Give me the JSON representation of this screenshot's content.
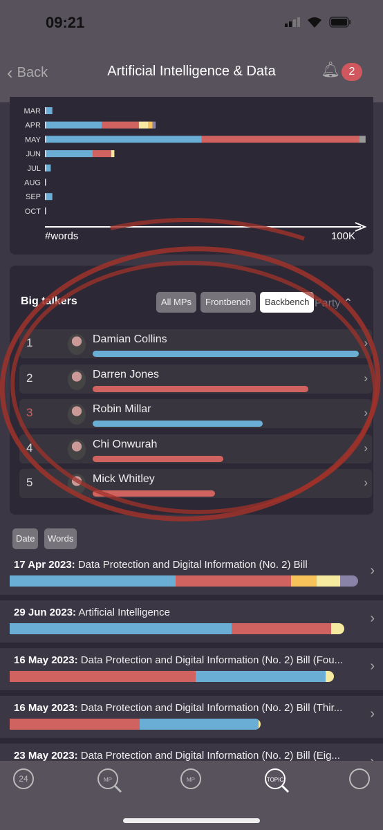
{
  "status": {
    "time": "09:21"
  },
  "nav": {
    "back": "Back",
    "title": "Artificial Intelligence & Data",
    "notifications": "2"
  },
  "colors": {
    "conservative": "#6aaed6",
    "labour": "#d0625f",
    "libdem": "#f7c25a",
    "snp": "#f5eaa0",
    "other": "#8a83a8",
    "grey": "#999999"
  },
  "chart_data": {
    "type": "bar",
    "orientation": "horizontal",
    "stacked": true,
    "categories": [
      "MAR",
      "APR",
      "MAY",
      "JUN",
      "JUL",
      "AUG",
      "SEP",
      "OCT"
    ],
    "xlabel": "#words",
    "xmax_label": "100K",
    "xlim": [
      0,
      100000
    ],
    "series": [
      {
        "color": "#6aaed6",
        "values": [
          2000,
          17500,
          49000,
          14700,
          1500,
          0,
          2000,
          0
        ]
      },
      {
        "color": "#d0625f",
        "values": [
          0,
          11700,
          49500,
          5800,
          0,
          0,
          0,
          0
        ]
      },
      {
        "color": "#f5eaa0",
        "values": [
          0,
          3000,
          0,
          1000,
          0,
          0,
          0,
          0
        ]
      },
      {
        "color": "#f7c25a",
        "values": [
          0,
          1300,
          0,
          0,
          0,
          0,
          0,
          0
        ]
      },
      {
        "color": "#8a83a8",
        "values": [
          0,
          1000,
          0,
          0,
          0,
          0,
          0,
          0
        ]
      },
      {
        "color": "#999999",
        "values": [
          0,
          0,
          2000,
          0,
          0,
          0,
          0,
          0
        ]
      }
    ]
  },
  "big_talkers": {
    "title": "Big talkers",
    "filters": [
      "All MPs",
      "Frontbench",
      "Backbench"
    ],
    "active_filter": "Backbench",
    "sort": "Party",
    "items": [
      {
        "rank": "1",
        "name": "Damian Collins",
        "share": 1.0,
        "color": "#6aaed6"
      },
      {
        "rank": "2",
        "name": "Darren Jones",
        "share": 0.81,
        "color": "#d0625f"
      },
      {
        "rank": "3",
        "name": "Robin Millar",
        "share": 0.64,
        "color": "#6aaed6"
      },
      {
        "rank": "4",
        "name": "Chi Onwurah",
        "share": 0.49,
        "color": "#d0625f"
      },
      {
        "rank": "5",
        "name": "Mick Whitley",
        "share": 0.46,
        "color": "#d0625f"
      }
    ]
  },
  "sort_buttons": [
    "Date",
    "Words"
  ],
  "debates": [
    {
      "date": "17 Apr 2023:",
      "title": "Data Protection and Digital Information (No. 2) Bill",
      "length": 1.0,
      "segments": [
        [
          "#6aaed6",
          0.476
        ],
        [
          "#d0625f",
          0.331
        ],
        [
          "#f7c25a",
          0.073
        ],
        [
          "#f5eaa0",
          0.068
        ],
        [
          "#8a83a8",
          0.052
        ]
      ]
    },
    {
      "date": "29 Jun 2023:",
      "title": "Artificial Intelligence",
      "length": 0.96,
      "segments": [
        [
          "#6aaed6",
          0.663
        ],
        [
          "#d0625f",
          0.298
        ],
        [
          "#f5eaa0",
          0.039
        ]
      ]
    },
    {
      "date": "16 May 2023:",
      "title": "Data Protection and Digital Information (No. 2) Bill (Fou...",
      "length": 0.93,
      "segments": [
        [
          "#d0625f",
          0.574
        ],
        [
          "#6aaed6",
          0.401
        ],
        [
          "#f5eaa0",
          0.025
        ]
      ]
    },
    {
      "date": "16 May 2023:",
      "title": "Data Protection and Digital Information (No. 2) Bill (Thir...",
      "length": 0.72,
      "segments": [
        [
          "#d0625f",
          0.517
        ],
        [
          "#6aaed6",
          0.475
        ],
        [
          "#f5eaa0",
          0.008
        ]
      ]
    },
    {
      "date": "23 May 2023:",
      "title": "Data Protection and Digital Information (No. 2) Bill (Eig...",
      "length": 0,
      "segments": []
    }
  ],
  "tabs": [
    {
      "icon": "24-hours-icon",
      "label": "24"
    },
    {
      "icon": "mp-search-icon",
      "label": "MP"
    },
    {
      "icon": "mp-trophy-icon",
      "label": "MP"
    },
    {
      "icon": "topic-search-icon",
      "label": "TOPIC"
    },
    {
      "icon": "settings-gear-icon",
      "label": ""
    }
  ]
}
